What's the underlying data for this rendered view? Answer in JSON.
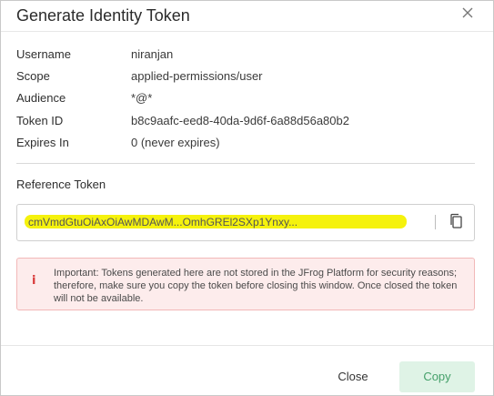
{
  "dialog": {
    "title": "Generate Identity Token"
  },
  "details": [
    {
      "label": "Username",
      "value": "niranjan"
    },
    {
      "label": "Scope",
      "value": "applied-permissions/user"
    },
    {
      "label": "Audience",
      "value": "*@*"
    },
    {
      "label": "Token ID",
      "value": "b8c9aafc-eed8-40da-9d6f-6a88d56a80b2"
    },
    {
      "label": "Expires In",
      "value": "0 (never expires)"
    }
  ],
  "reference_token": {
    "label": "Reference Token",
    "value": "cmVmdGtuOiAxOiAwMDAwM...OmhGREl2SXp1Ynxy..."
  },
  "alert": {
    "icon": "info-icon",
    "text": "Important: Tokens generated here are not stored in the JFrog Platform for security reasons; therefore, make sure you copy the token before closing this window. Once closed the token will not be available."
  },
  "footer": {
    "close_label": "Close",
    "copy_label": "Copy"
  },
  "colors": {
    "highlight": "#f4f100",
    "alert_bg": "#fdecec",
    "alert_icon": "#d83b3b",
    "copy_btn_bg": "#dff3e6",
    "copy_btn_text": "#45a06a"
  }
}
